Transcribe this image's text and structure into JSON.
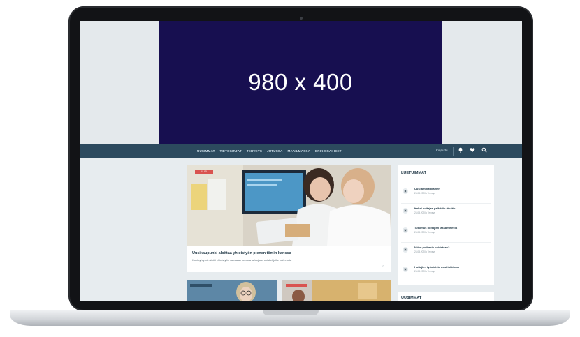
{
  "ad": {
    "label": "980 x 400"
  },
  "nav": {
    "items": [
      "UUSIMMAT",
      "TIETOKIRJAT",
      "TERVEYS",
      "JUTUSSA",
      "MAAILMASSA",
      "ERIKOISAIHEET"
    ],
    "login": "Kirjaudu",
    "icons": [
      "bell-icon",
      "heart-icon",
      "search-icon"
    ]
  },
  "lead": {
    "tag": "UUSI",
    "title": "Uusikaupunki aloittaa yhteistyön pienen tiimin kanssa",
    "subtitle": "Kuntayhtymä aloitti yhteistyön sairaalan kanssa ja tarjoaa opiskelijoille palveluita",
    "count": "12"
  },
  "sidebar": {
    "title": "LUETUIMMAT",
    "items": [
      {
        "text": "Uusi ammattilainen",
        "meta": "23.03.2020 • Terveys"
      },
      {
        "text": "Kaksi hoitajaa palkittiin tänään",
        "meta": "23.03.2020 • Terveys"
      },
      {
        "text": "Tutkimus hoitajien jaksamisesta",
        "meta": "23.03.2020 • Terveys"
      },
      {
        "text": "Miten potilasta hoidetaan?",
        "meta": "23.03.2020 • Terveys"
      },
      {
        "text": "Hoitajien työoloista uusi tutkimus",
        "meta": "23.03.2020 • Terveys"
      }
    ]
  },
  "sidebar2": {
    "title": "UUSIMMAT"
  },
  "colors": {
    "nav": "#2c4a5e",
    "ad": "#170f50",
    "accent": "#d9534f"
  }
}
